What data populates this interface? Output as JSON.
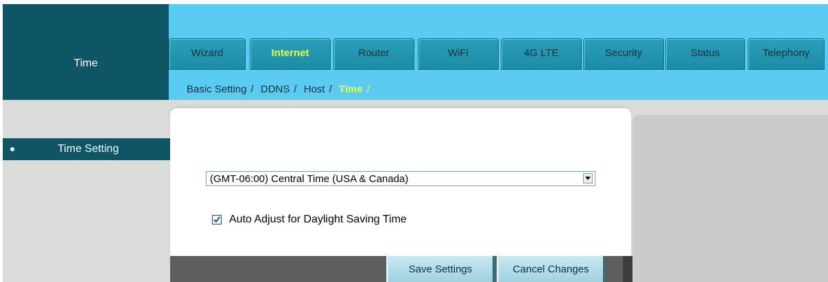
{
  "sidebar": {
    "header_title": "Time",
    "items": [
      {
        "label": "Time Setting",
        "active": true
      }
    ]
  },
  "nav": {
    "tabs": [
      {
        "label": "Wizard",
        "active": false
      },
      {
        "label": "Internet",
        "active": true
      },
      {
        "label": "Router",
        "active": false
      },
      {
        "label": "WiFi",
        "active": false
      },
      {
        "label": "4G LTE",
        "active": false
      },
      {
        "label": "Security",
        "active": false
      },
      {
        "label": "Status",
        "active": false
      },
      {
        "label": "Telephony",
        "active": false
      }
    ],
    "subnav": [
      {
        "label": "Basic Setting",
        "active": false
      },
      {
        "label": "DDNS",
        "active": false
      },
      {
        "label": "Host",
        "active": false
      },
      {
        "label": "Time",
        "active": true
      }
    ],
    "separator": "/"
  },
  "form": {
    "timezone": {
      "value": "(GMT-06:00) Central Time (USA & Canada)"
    },
    "daylight_saving": {
      "label": "Auto Adjust for Daylight Saving Time",
      "checked": true
    }
  },
  "buttons": {
    "save_label": "Save Settings",
    "cancel_label": "Cancel Changes"
  },
  "colors": {
    "dark_teal": "#0e5566",
    "sky_blue": "#5ccbf2",
    "tab_teal": "#1e8ba5",
    "active_yellow": "#eaff3c",
    "panel_gray": "#d9dcd9"
  }
}
